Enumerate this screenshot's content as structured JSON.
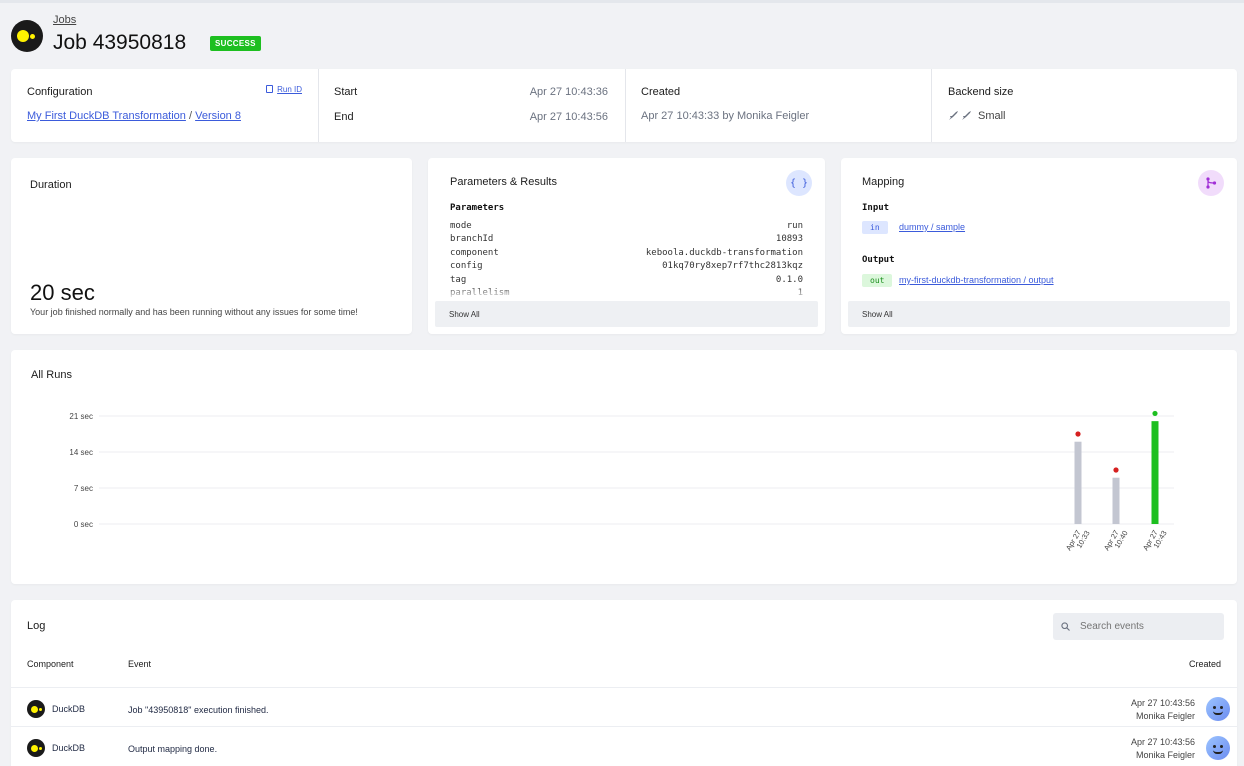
{
  "header": {
    "breadcrumb": "Jobs",
    "title": "Job 43950818",
    "status": "SUCCESS",
    "status_color": "#1dbf20"
  },
  "info": {
    "configuration_label": "Configuration",
    "run_id_label": "Run ID",
    "config_link": "My First DuckDB Transformation",
    "config_sep": "/",
    "version_link": "Version 8",
    "start_label": "Start",
    "start_value": "Apr 27 10:43:36",
    "end_label": "End",
    "end_value": "Apr 27 10:43:56",
    "created_label": "Created",
    "created_value": "Apr 27 10:43:33 by Monika Feigler",
    "backend_label": "Backend size",
    "backend_value": "Small"
  },
  "duration": {
    "title": "Duration",
    "value": "20 sec",
    "note": "Your job finished normally and has been running without any issues for some time!"
  },
  "params": {
    "title": "Parameters & Results",
    "subtitle": "Parameters",
    "rows": [
      {
        "k": "mode",
        "v": "run"
      },
      {
        "k": "branchId",
        "v": "10893"
      },
      {
        "k": "component",
        "v": "keboola.duckdb-transformation"
      },
      {
        "k": "config",
        "v": "01kq70ry8xep7rf7thc2813kqz"
      },
      {
        "k": "tag",
        "v": "0.1.0"
      },
      {
        "k": "parallelism",
        "v": "1"
      }
    ],
    "show_all": "Show All"
  },
  "mapping": {
    "title": "Mapping",
    "input_label": "Input",
    "input_tag": "in",
    "input_link": "dummy / sample",
    "output_label": "Output",
    "output_tag": "out",
    "output_link": "my-first-duckdb-transformation / output",
    "show_all": "Show All"
  },
  "runs": {
    "title": "All Runs"
  },
  "chart_data": {
    "type": "bar",
    "title": "All Runs",
    "y_ticks": [
      "0 sec",
      "7 sec",
      "14 sec",
      "21 sec"
    ],
    "ylim": [
      0,
      21
    ],
    "categories": [
      "Apr 27 10:33",
      "Apr 27 10:40",
      "Apr 27 10:43"
    ],
    "category_lines": [
      [
        "Apr 27",
        "10:33"
      ],
      [
        "Apr 27",
        "10:40"
      ],
      [
        "Apr 27",
        "10:43"
      ]
    ],
    "values": [
      16,
      9,
      20
    ],
    "bar_colors": [
      "#c3c6d1",
      "#c3c6d1",
      "#1dbf20"
    ],
    "status_dots": [
      17.5,
      10.5,
      21.5
    ],
    "dot_colors": [
      "#d62020",
      "#d62020",
      "#1dbf20"
    ],
    "grid": true
  },
  "log": {
    "title": "Log",
    "search_placeholder": "Search events",
    "col_component": "Component",
    "col_event": "Event",
    "col_created": "Created",
    "rows": [
      {
        "component": "DuckDB",
        "event": "Job \"43950818\" execution finished.",
        "time": "Apr 27 10:43:56",
        "user": "Monika Feigler"
      },
      {
        "component": "DuckDB",
        "event": "Output mapping done.",
        "time": "Apr 27 10:43:56",
        "user": "Monika Feigler"
      }
    ]
  }
}
